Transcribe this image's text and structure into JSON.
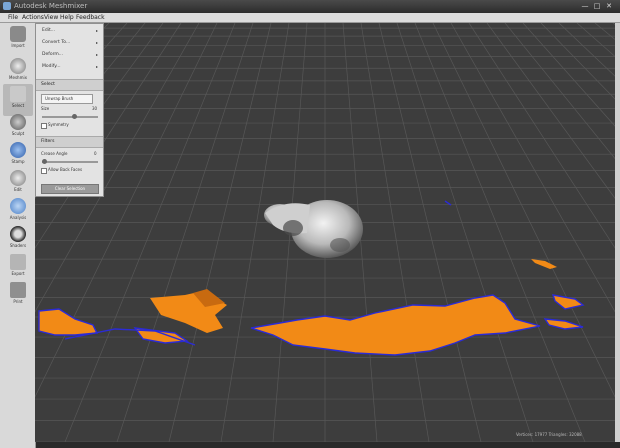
{
  "window": {
    "title": "Autodesk Meshmixer",
    "controls": [
      "—",
      "□",
      "✕"
    ]
  },
  "menu": [
    "File",
    "Actions",
    "View",
    "Help",
    "Feedback"
  ],
  "toolbar": [
    {
      "label": "Import",
      "icon": "plus-icon",
      "color": "#7c7c7c"
    },
    {
      "label": "Meshmix",
      "icon": "meshmix-icon",
      "color": "#8a8a8a"
    },
    {
      "label": "Select",
      "icon": "select-arrow-icon",
      "color": "#9a9a9a"
    },
    {
      "label": "Sculpt",
      "icon": "sculpt-brush-icon",
      "color": "#6e6e6e"
    },
    {
      "label": "Stamp",
      "icon": "stamp-icon",
      "color": "#4a78c4"
    },
    {
      "label": "Edit",
      "icon": "edit-icon",
      "color": "#8c8c8c"
    },
    {
      "label": "Analysis",
      "icon": "analysis-icon",
      "color": "#5f8fd0"
    },
    {
      "label": "Shaders",
      "icon": "shaders-icon",
      "color": "#444444"
    },
    {
      "label": "Export",
      "icon": "export-icon",
      "color": "#7c7c7c"
    },
    {
      "label": "Print",
      "icon": "print-icon",
      "color": "#7c7c7c"
    }
  ],
  "panel": {
    "actions": [
      {
        "label": "Edit..."
      },
      {
        "label": "Convert To..."
      },
      {
        "label": "Deform..."
      },
      {
        "label": "Modify..."
      }
    ],
    "select_section": "Select",
    "brush_dropdown": "Unwrap Brush",
    "size_label": "Size",
    "size_value": "30",
    "symmetry_label": "Symmetry",
    "filters_section": "Filters",
    "crease_label": "Crease Angle",
    "crease_value": "0",
    "allow_back_label": "Allow Back Faces",
    "clear_label": "Clear Selection"
  },
  "status": "Vertices: 17977 Triangles: 32088",
  "colors": {
    "selection_orange": "#f28a16",
    "boundary_blue": "#2b2bd6",
    "grid": "#5a5a5a",
    "background": "#3d3d3d"
  }
}
